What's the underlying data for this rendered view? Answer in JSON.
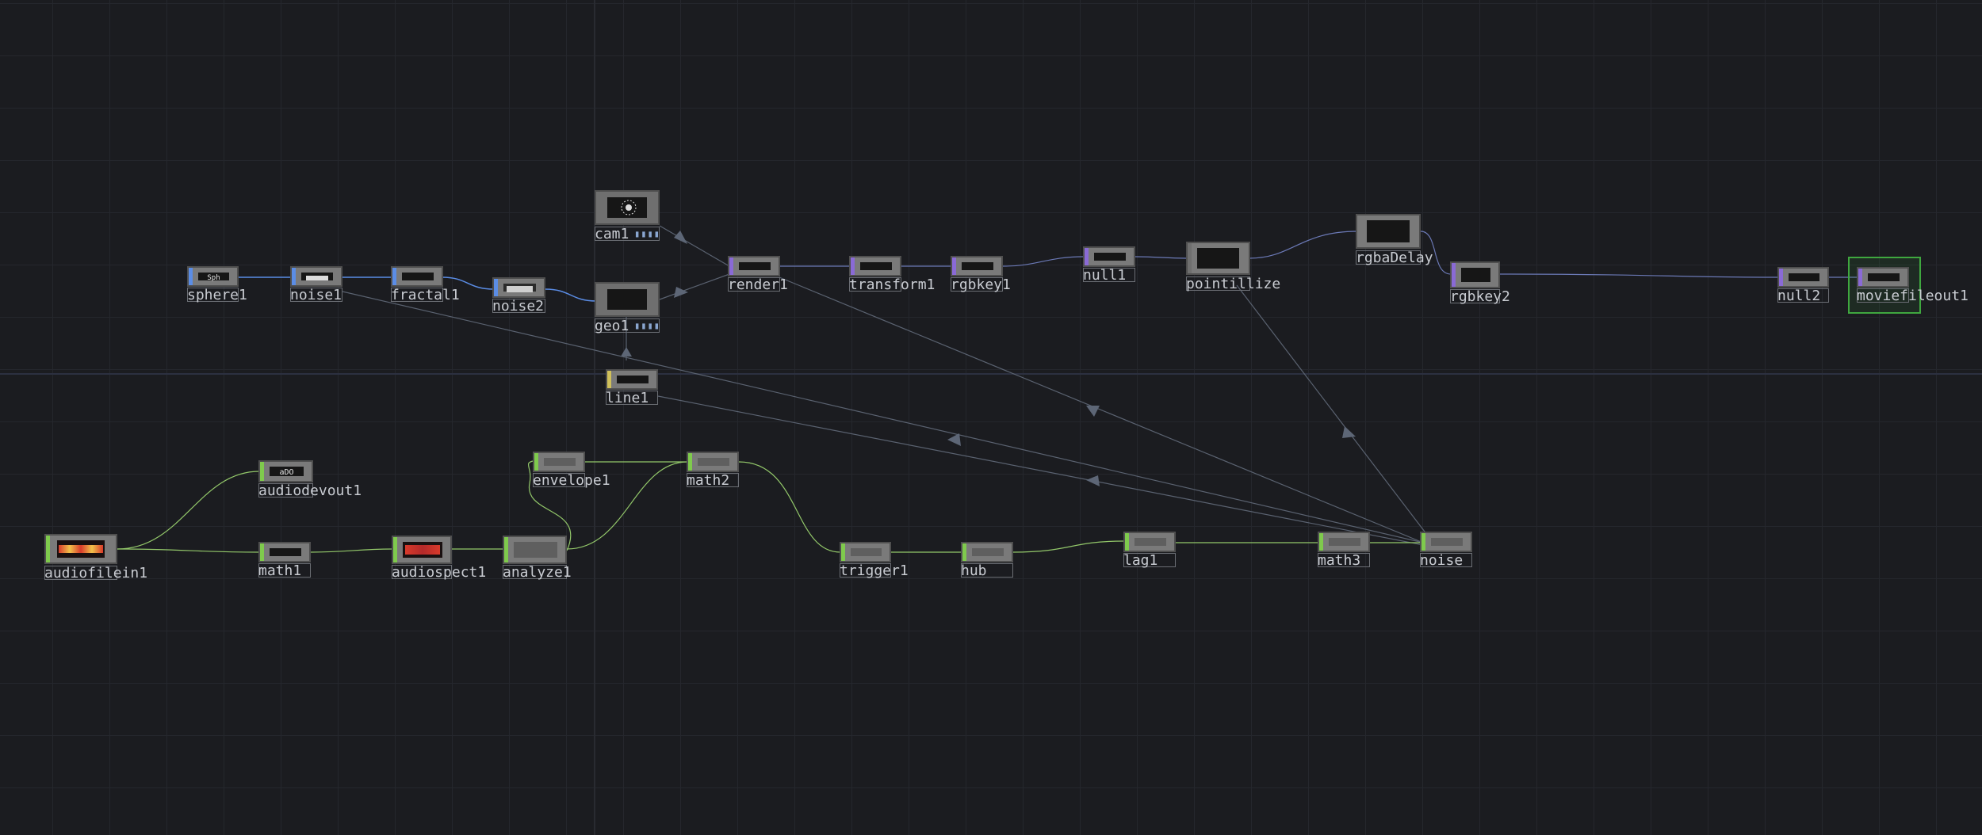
{
  "colors": {
    "background": "#1b1c20",
    "top_wire": "#6b79b6",
    "chop_wire": "#93c86a",
    "reference_wire": "#5a6270",
    "selected": "#3fa73f",
    "sop_stripe": "#5b8de6",
    "comp_stripe": "#8c8c8c",
    "top_stripe": "#8a6ad6",
    "chop_stripe": "#7fca4d",
    "dat_stripe": "#d0c05a"
  },
  "nodes": {
    "sphere1": {
      "label": "sphere1",
      "preview": "Sph",
      "family": "SOP"
    },
    "noise1": {
      "label": "noise1",
      "family": "SOP"
    },
    "fractal1": {
      "label": "fractal1",
      "family": "SOP"
    },
    "noise2": {
      "label": "noise2",
      "family": "SOP"
    },
    "cam1": {
      "label": "cam1",
      "family": "COMP"
    },
    "geo1": {
      "label": "geo1",
      "family": "COMP"
    },
    "line1": {
      "label": "line1",
      "family": "DAT"
    },
    "render1": {
      "label": "render1",
      "family": "TOP"
    },
    "transform1": {
      "label": "transform1",
      "family": "TOP"
    },
    "rgbkey1": {
      "label": "rgbkey1",
      "family": "TOP"
    },
    "null1": {
      "label": "null1",
      "family": "TOP"
    },
    "pointillize": {
      "label": "pointillize",
      "family": "TOP"
    },
    "rgbaDelay": {
      "label": "rgbaDelay",
      "family": "TOP"
    },
    "rgbkey2": {
      "label": "rgbkey2",
      "family": "TOP"
    },
    "null2": {
      "label": "null2",
      "family": "TOP"
    },
    "moviefileout1": {
      "label": "moviefileout1",
      "family": "TOP",
      "selected": true
    },
    "audiodevout1": {
      "label": "audiodevout1",
      "preview": "aDO",
      "family": "CHOP"
    },
    "audiofilein1": {
      "label": "audiofilein1",
      "family": "CHOP"
    },
    "math1": {
      "label": "math1",
      "family": "CHOP"
    },
    "audiospect1": {
      "label": "audiospect1",
      "family": "CHOP"
    },
    "analyze1": {
      "label": "analyze1",
      "family": "CHOP"
    },
    "envelope1": {
      "label": "envelope1",
      "family": "CHOP"
    },
    "math2": {
      "label": "math2",
      "family": "CHOP"
    },
    "trigger1": {
      "label": "trigger1",
      "family": "CHOP"
    },
    "hub": {
      "label": "hub",
      "family": "CHOP"
    },
    "lag1": {
      "label": "lag1",
      "family": "CHOP"
    },
    "math3": {
      "label": "math3",
      "family": "CHOP"
    },
    "noise": {
      "label": "noise",
      "family": "CHOP"
    }
  }
}
